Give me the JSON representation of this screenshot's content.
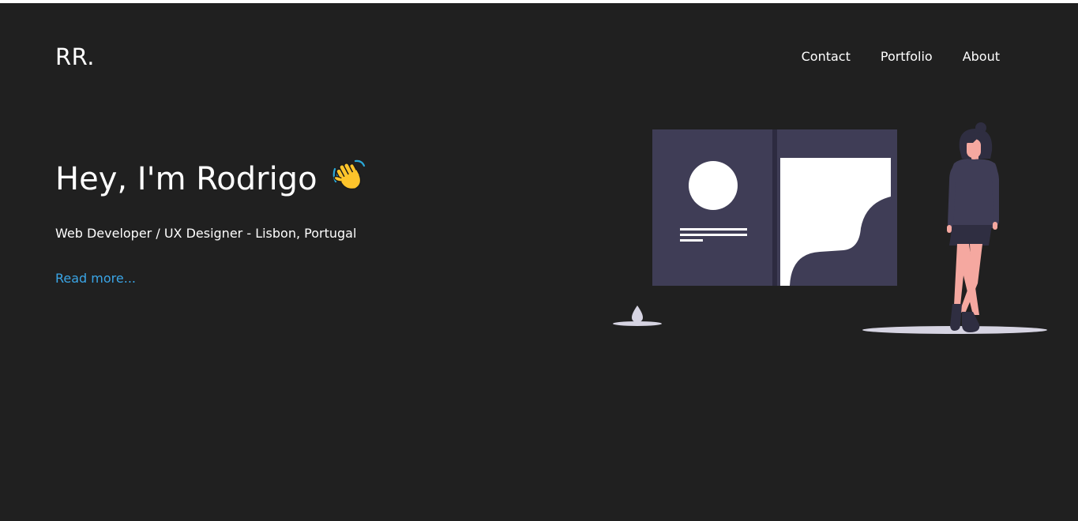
{
  "header": {
    "logo": "RR.",
    "nav": [
      {
        "label": "Contact"
      },
      {
        "label": "Portfolio"
      },
      {
        "label": "About"
      }
    ]
  },
  "hero": {
    "title": "Hey, I'm Rodrigo",
    "title_icon": "waving-hand-icon",
    "subtitle": "Web Developer / UX Designer - Lisbon, Portugal",
    "read_more": "Read more..."
  },
  "illustration": {
    "name": "person-with-portfolio-board-illustration"
  },
  "colors": {
    "background": "#202020",
    "text": "#ffffff",
    "link": "#3aa5e6",
    "board": "#3f3d56",
    "shadow": "#d6d4e2"
  }
}
